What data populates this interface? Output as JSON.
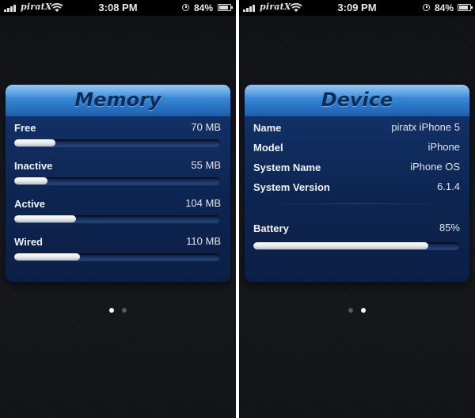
{
  "left": {
    "status": {
      "carrier": "piratX",
      "time": "3:08 PM",
      "battery_pct": "84%",
      "battery_fill": 0.84
    },
    "title": "Memory",
    "rows": [
      {
        "label": "Free",
        "value": "70 MB",
        "fraction": 0.2
      },
      {
        "label": "Inactive",
        "value": "55 MB",
        "fraction": 0.16
      },
      {
        "label": "Active",
        "value": "104 MB",
        "fraction": 0.3
      },
      {
        "label": "Wired",
        "value": "110 MB",
        "fraction": 0.32
      }
    ],
    "page_index": 0
  },
  "right": {
    "status": {
      "carrier": "piratX",
      "time": "3:09 PM",
      "battery_pct": "84%",
      "battery_fill": 0.84
    },
    "title": "Device",
    "rows": [
      {
        "label": "Name",
        "value": "piratx iPhone 5"
      },
      {
        "label": "Model",
        "value": "iPhone"
      },
      {
        "label": "System Name",
        "value": "iPhone OS"
      },
      {
        "label": "System Version",
        "value": "6.1.4"
      }
    ],
    "battery": {
      "label": "Battery",
      "value": "85%",
      "fraction": 0.85
    },
    "page_index": 1
  },
  "colors": {
    "header_blue": "#3c8dd8",
    "card_blue": "#0d2552",
    "bar_fill": "#e4e7ec"
  },
  "icons": [
    "signal-bars-icon",
    "wifi-icon",
    "alarm-icon",
    "battery-icon"
  ]
}
